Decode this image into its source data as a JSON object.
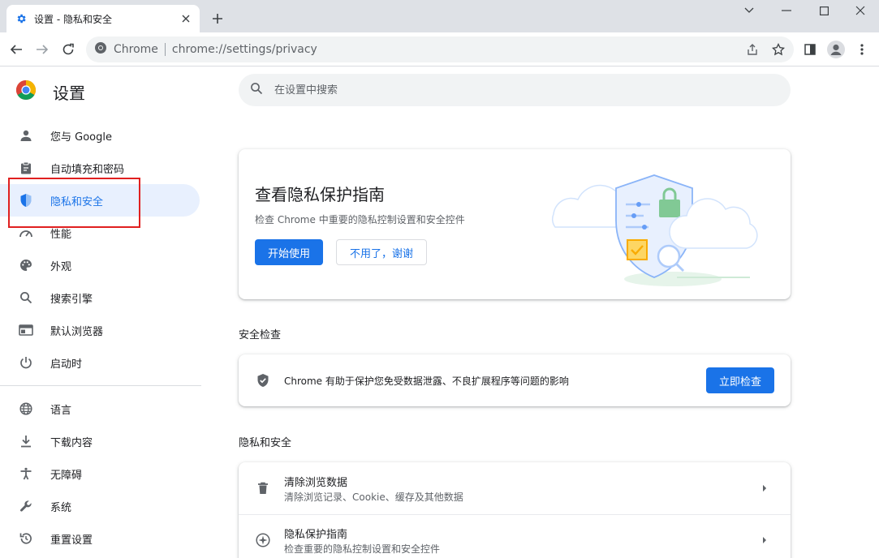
{
  "tab": {
    "title": "设置 - 隐私和安全"
  },
  "omnibox": {
    "site": "Chrome",
    "url": "chrome://settings/privacy"
  },
  "brand": {
    "title": "设置"
  },
  "search": {
    "placeholder": "在设置中搜索"
  },
  "sidebar": {
    "items": [
      {
        "label": "您与 Google",
        "icon": "person-icon"
      },
      {
        "label": "自动填充和密码",
        "icon": "clipboard-icon"
      },
      {
        "label": "隐私和安全",
        "icon": "shield-icon",
        "active": true
      },
      {
        "label": "性能",
        "icon": "speedometer-icon"
      },
      {
        "label": "外观",
        "icon": "palette-icon"
      },
      {
        "label": "搜索引擎",
        "icon": "search-icon"
      },
      {
        "label": "默认浏览器",
        "icon": "browser-icon"
      },
      {
        "label": "启动时",
        "icon": "power-icon"
      },
      {
        "label": "语言",
        "icon": "globe-icon"
      },
      {
        "label": "下载内容",
        "icon": "download-icon"
      },
      {
        "label": "无障碍",
        "icon": "accessibility-icon"
      },
      {
        "label": "系统",
        "icon": "wrench-icon"
      },
      {
        "label": "重置设置",
        "icon": "reset-icon"
      }
    ]
  },
  "promo": {
    "title": "查看隐私保护指南",
    "subtitle": "检查 Chrome 中重要的隐私控制设置和安全控件",
    "start_label": "开始使用",
    "dismiss_label": "不用了，谢谢"
  },
  "safety": {
    "section_title": "安全检查",
    "text": "Chrome 有助于保护您免受数据泄露、不良扩展程序等问题的影响",
    "button_label": "立即检查"
  },
  "privacy": {
    "section_title": "隐私和安全",
    "rows": [
      {
        "title": "清除浏览数据",
        "subtitle": "清除浏览记录、Cookie、缓存及其他数据",
        "icon": "trash-icon"
      },
      {
        "title": "隐私保护指南",
        "subtitle": "检查重要的隐私控制设置和安全控件",
        "icon": "compass-icon"
      }
    ]
  },
  "colors": {
    "accent": "#1a73e8",
    "active_bg": "#e8f0fe",
    "highlight": "#e02020"
  }
}
